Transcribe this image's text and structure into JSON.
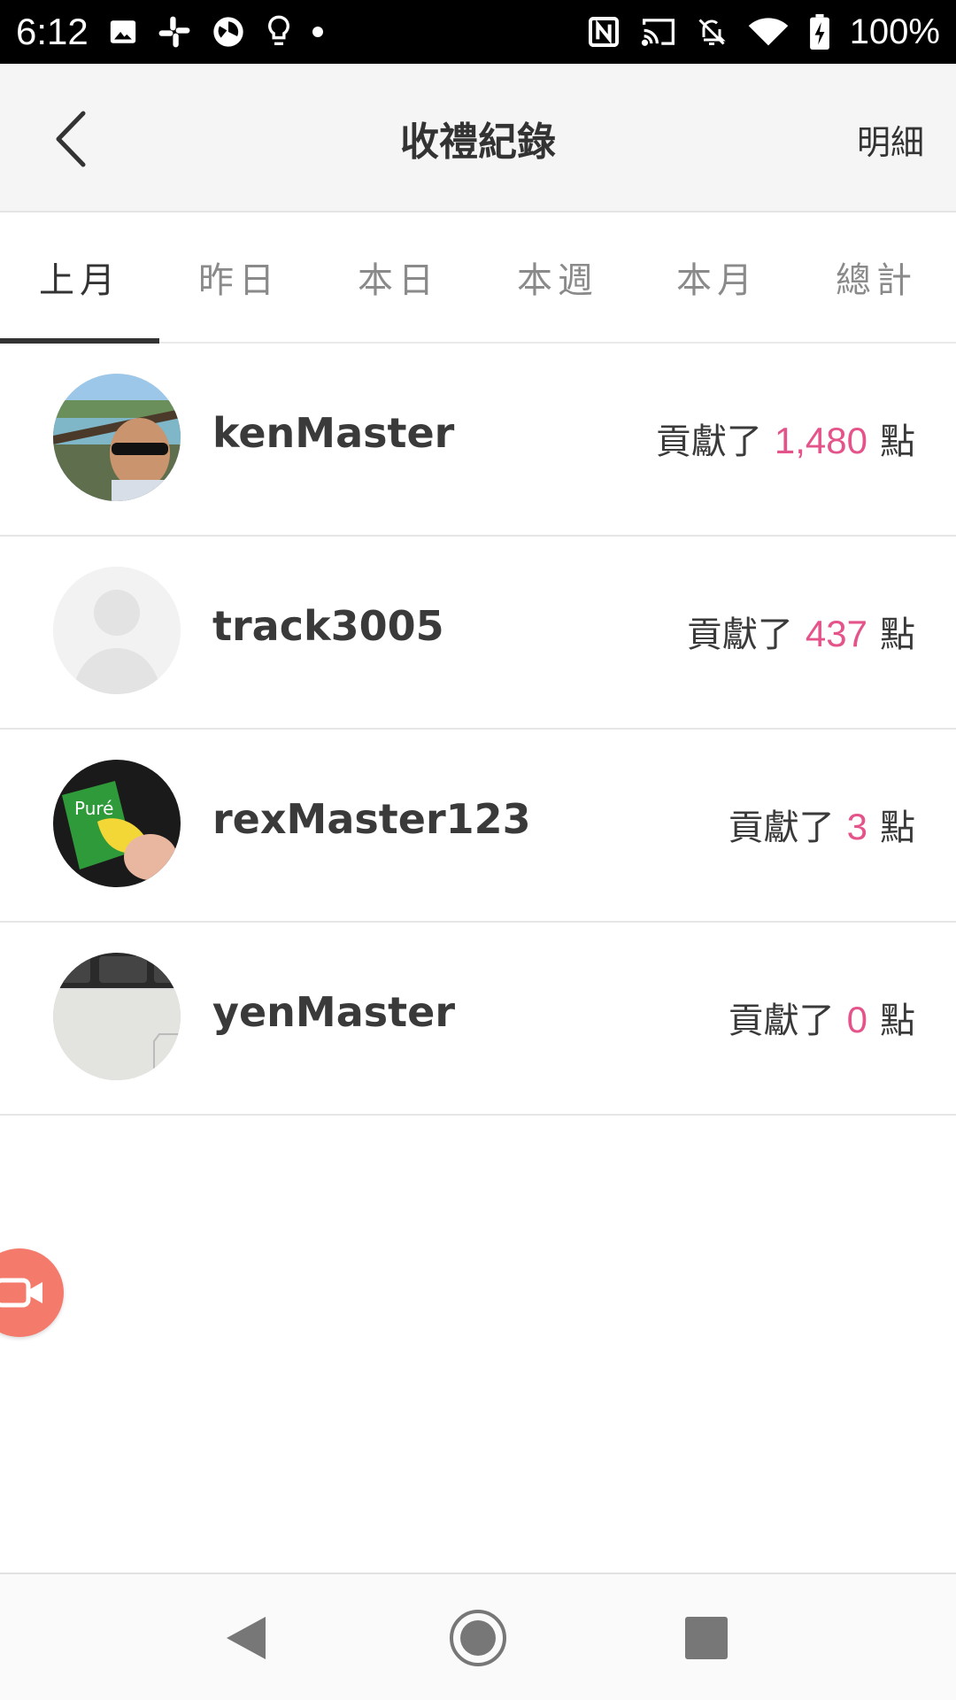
{
  "status_bar": {
    "time": "6:12",
    "battery": "100%",
    "left_icons": [
      "image-icon",
      "slack-icon",
      "aperture-icon",
      "lightbulb-icon",
      "dot-icon"
    ],
    "right_icons": [
      "nfc-icon",
      "cast-icon",
      "bell-off-icon",
      "wifi-icon",
      "battery-charging-icon"
    ]
  },
  "header": {
    "title": "收禮紀錄",
    "detail_label": "明細"
  },
  "tabs": [
    {
      "label": "上月",
      "active": true
    },
    {
      "label": "昨日",
      "active": false
    },
    {
      "label": "本日",
      "active": false
    },
    {
      "label": "本週",
      "active": false
    },
    {
      "label": "本月",
      "active": false
    },
    {
      "label": "總計",
      "active": false
    }
  ],
  "records": [
    {
      "username": "kenMaster",
      "prefix": "貢獻了",
      "points": "1,480",
      "suffix": "點"
    },
    {
      "username": "track3005",
      "prefix": "貢獻了",
      "points": "437",
      "suffix": "點"
    },
    {
      "username": "rexMaster123",
      "prefix": "貢獻了",
      "points": "3",
      "suffix": "點"
    },
    {
      "username": "yenMaster",
      "prefix": "貢獻了",
      "points": "0",
      "suffix": "點"
    }
  ],
  "colors": {
    "points": "#e4548a",
    "float_button": "#f47b6b",
    "header_bg": "#f5f5f5"
  }
}
